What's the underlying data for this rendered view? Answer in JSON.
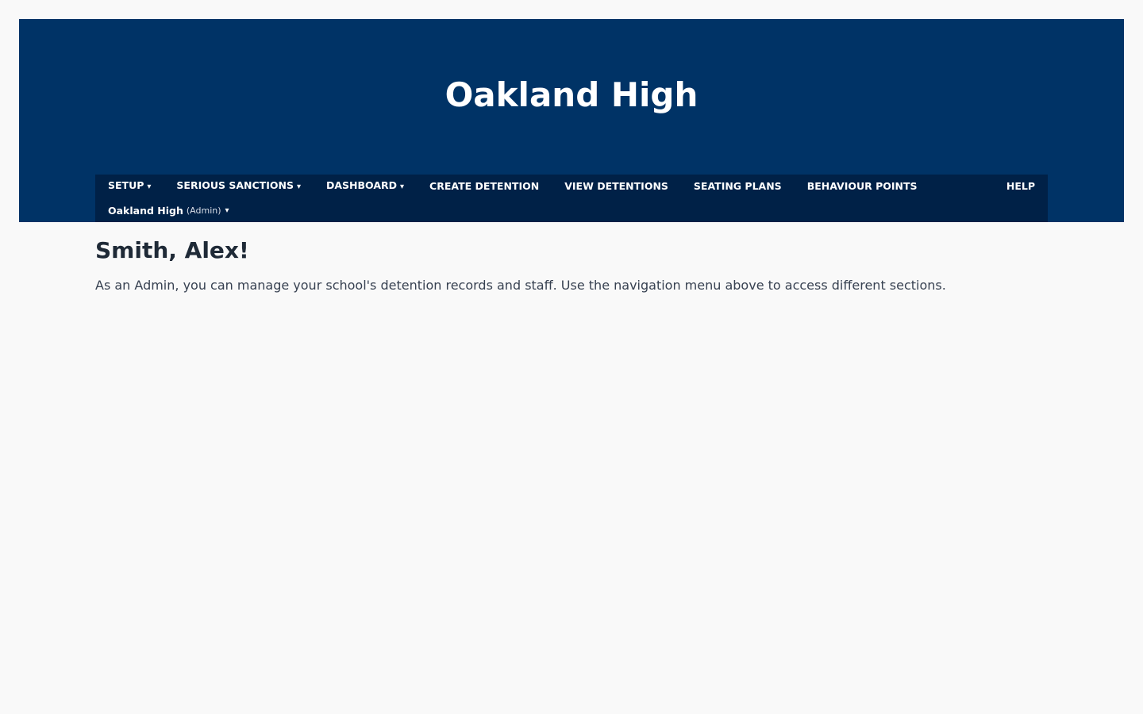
{
  "header": {
    "title": "Oakland High"
  },
  "nav": {
    "items": [
      {
        "label": "SETUP",
        "caret": "▾"
      },
      {
        "label": "SERIOUS SANCTIONS",
        "caret": "▾"
      },
      {
        "label": "DASHBOARD",
        "caret": "▾"
      },
      {
        "label": "CREATE DETENTION",
        "caret": ""
      },
      {
        "label": "VIEW DETENTIONS",
        "caret": ""
      },
      {
        "label": "SEATING PLANS",
        "caret": ""
      },
      {
        "label": "BEHAVIOUR POINTS",
        "caret": ""
      }
    ],
    "help": "HELP",
    "school": {
      "name": "Oakland High",
      "role": "(Admin)",
      "caret": "▾"
    }
  },
  "main": {
    "greeting": "Smith, Alex!",
    "intro": "As an Admin, you can manage your school's detention records and staff. Use the navigation menu above to access different sections."
  },
  "colors": {
    "header_bg": "#003366",
    "navbar_bg": "#002147",
    "page_bg": "#f9f9f9"
  }
}
